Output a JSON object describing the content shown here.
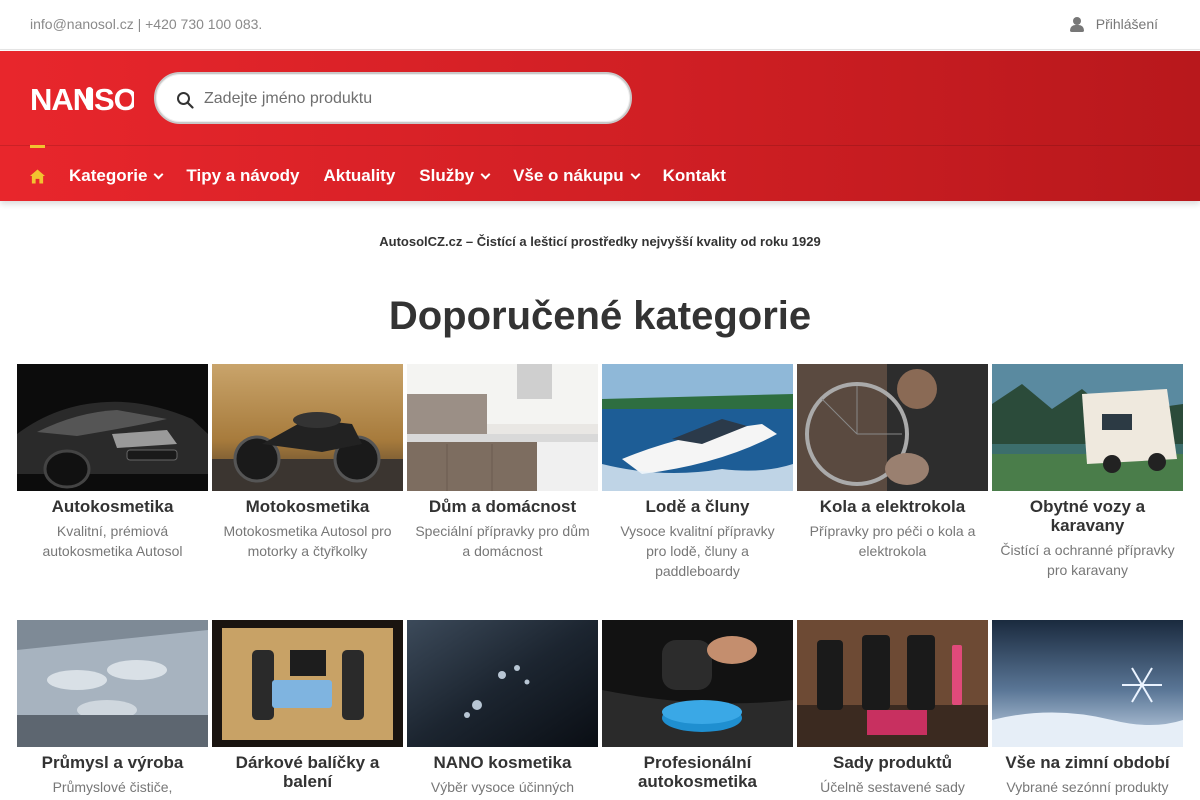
{
  "topbar": {
    "contact": "info@nanosol.cz | +420 730 100 083.",
    "login_label": "Přihlášení"
  },
  "header": {
    "logo_text": "NANOSOL",
    "search_placeholder": "Zadejte jméno produktu"
  },
  "nav": {
    "items": [
      {
        "label": "Kategorie",
        "dropdown": true
      },
      {
        "label": "Tipy a návody",
        "dropdown": false
      },
      {
        "label": "Aktuality",
        "dropdown": false
      },
      {
        "label": "Služby",
        "dropdown": true
      },
      {
        "label": "Vše o nákupu",
        "dropdown": true
      },
      {
        "label": "Kontakt",
        "dropdown": false
      }
    ]
  },
  "tagline": "AutosolCZ.cz – Čistící a lešticí prostředky nejvyšší kvality od roku 1929",
  "heading": "Doporučené kategorie",
  "categories": [
    {
      "title": "Autokosmetika",
      "desc": "Kvalitní, prémiová autokosmetika Autosol"
    },
    {
      "title": "Motokosmetika",
      "desc": "Motokosmetika Autosol pro motorky a čtyřkolky"
    },
    {
      "title": "Dům a domácnost",
      "desc": "Speciální přípravky pro dům a domácnost"
    },
    {
      "title": "Lodě a čluny",
      "desc": "Vysoce kvalitní přípravky pro lodě, čluny a paddleboardy"
    },
    {
      "title": "Kola a elektrokola",
      "desc": "Přípravky pro péči o kola a elektrokola"
    },
    {
      "title": "Obytné vozy a karavany",
      "desc": "Čistící a ochranné přípravky pro karavany"
    },
    {
      "title": "Průmysl a výroba",
      "desc": "Průmyslové čističe,"
    },
    {
      "title": "Dárkové balíčky a balení",
      "desc": ""
    },
    {
      "title": "NANO kosmetika",
      "desc": "Výběr vysoce účinných"
    },
    {
      "title": "Profesionální autokosmetika",
      "desc": ""
    },
    {
      "title": "Sady produktů",
      "desc": "Účelně sestavené sady"
    },
    {
      "title": "Vše na zimní období",
      "desc": "Vybrané sezónní produkty"
    }
  ],
  "colors": {
    "brand_red": "#e8262c",
    "accent_yellow": "#f2c230"
  }
}
